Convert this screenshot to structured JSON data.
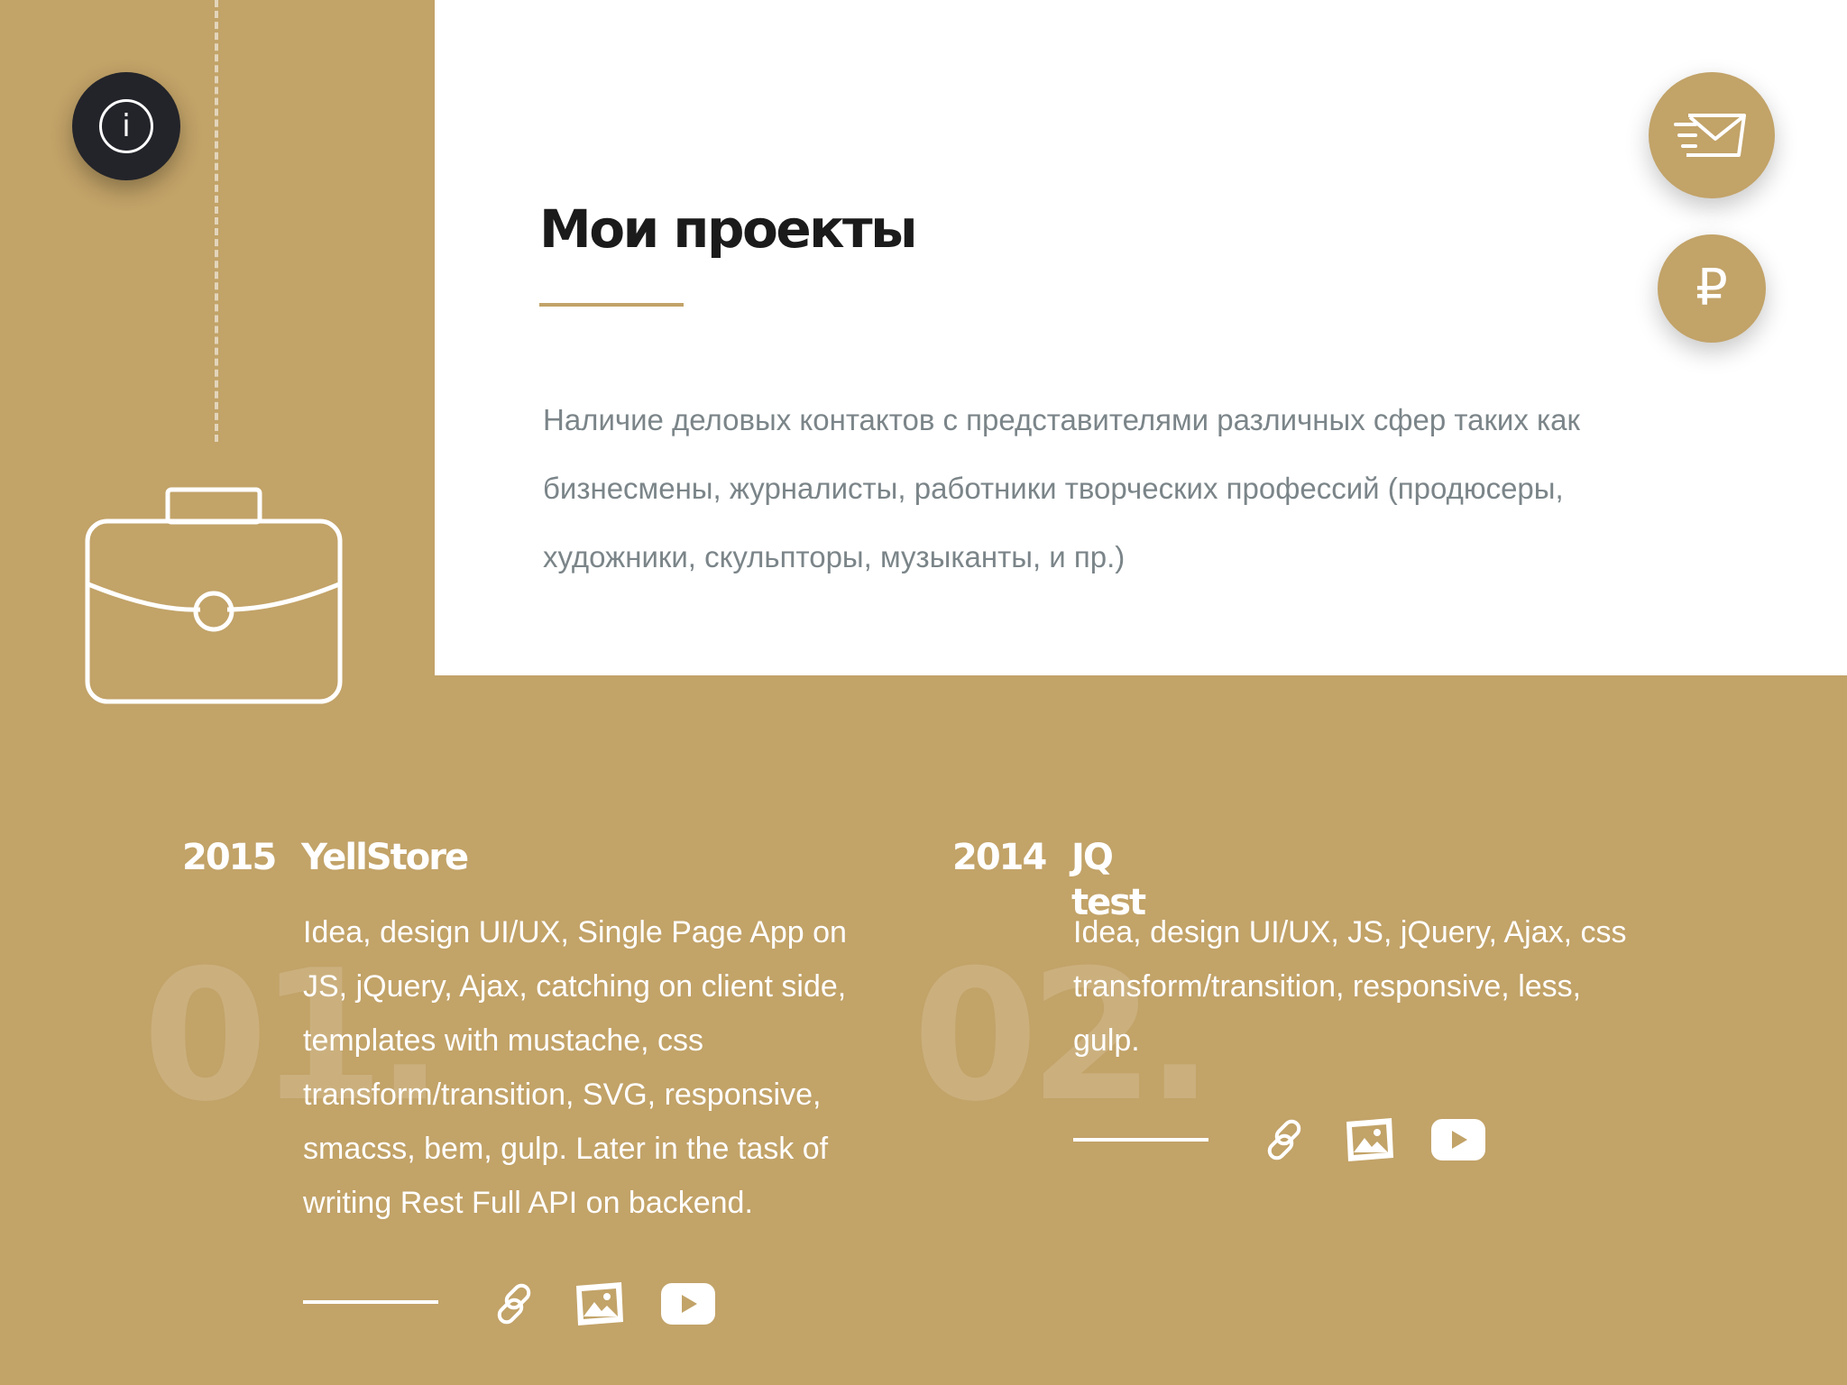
{
  "info_button": {
    "icon": "info-icon",
    "glyph": "i"
  },
  "sidebar": {
    "icon": "briefcase-icon"
  },
  "header": {
    "title": "Мои проекты",
    "intro": "Наличие деловых контактов с представителями различных сфер таких как бизнесмены, журналисты, работники творческих профессий (продюсеры, художники, скульпторы, музыканты, и пр.)"
  },
  "actions": {
    "mail": {
      "icon": "send-mail-icon"
    },
    "payment": {
      "icon": "ruble-icon",
      "glyph": "₽"
    }
  },
  "accent_color": "#c2a368",
  "projects": [
    {
      "number": "01.",
      "year": "2015",
      "name": "YellStore",
      "description": "Idea, design UI/UX, Single Page App on JS, jQuery, Ajax, catching on client side, templates with mustache, css transform/transition, SVG, responsive, smacss, bem, gulp. Later in the task of writing Rest Full API on backend.",
      "links": [
        "link-icon",
        "gallery-icon",
        "youtube-icon"
      ]
    },
    {
      "number": "02.",
      "year": "2014",
      "name": "JQ test",
      "description": "Idea, design UI/UX, JS, jQuery, Ajax, css transform/transition, responsive, less, gulp.",
      "links": [
        "link-icon",
        "gallery-icon",
        "youtube-icon"
      ]
    }
  ]
}
